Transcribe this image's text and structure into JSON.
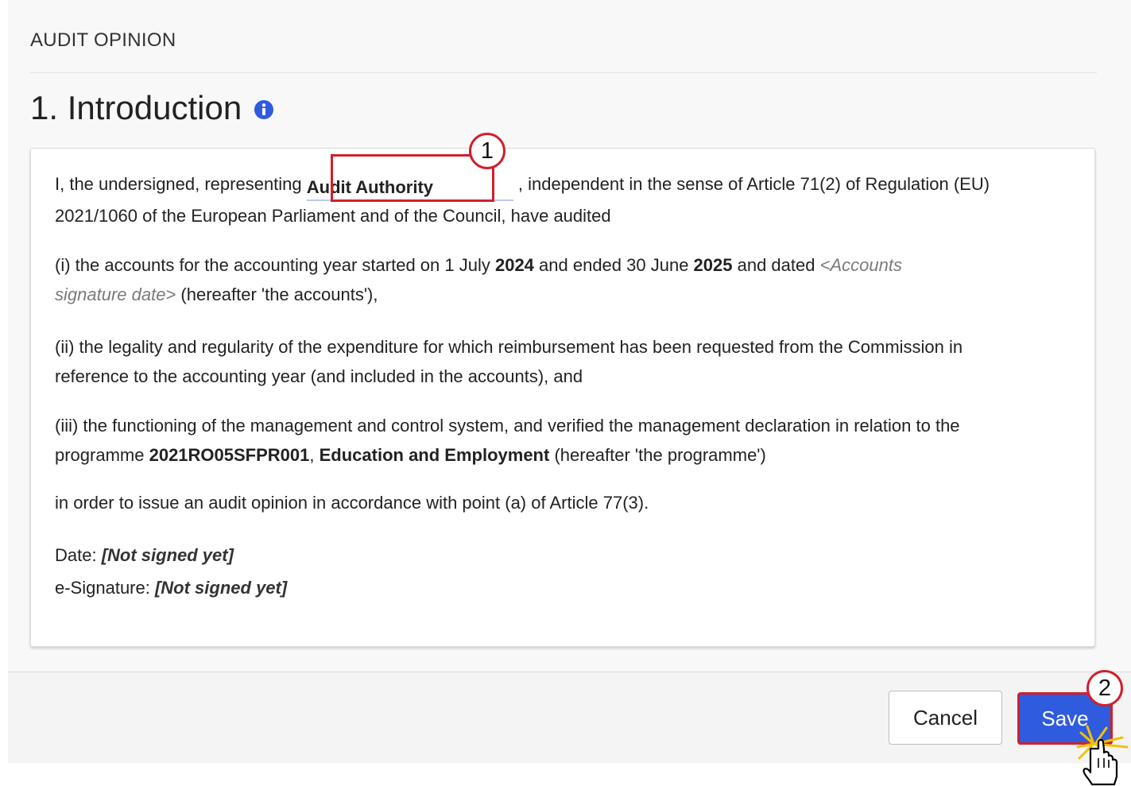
{
  "section": {
    "header": "AUDIT OPINION"
  },
  "title": "1. Introduction",
  "body": {
    "p1": {
      "prefix": "I, the undersigned, representing",
      "authority": "Audit Authority",
      "suffix": ", independent in the sense of Article 71(2) of Regulation (EU)",
      "line2": "2021/1060 of the European Parliament and of the Council, have audited"
    },
    "p2": {
      "part1": "(i) the accounts for the accounting year started on 1 July ",
      "year_start": "2024",
      "part2": " and ended 30 June ",
      "year_end": "2025",
      "part3": " and dated ",
      "placeholder_a": "<Accounts",
      "placeholder_b": "signature date>",
      "part4": " (hereafter 'the accounts'),"
    },
    "p3": {
      "line1": "(ii) the legality and regularity of the expenditure for which reimbursement has been requested from the Commission in",
      "line2": "reference to the accounting year (and included in the accounts), and"
    },
    "p4": {
      "line1": "(iii) the functioning of the management and control system, and verified the management declaration in relation to the",
      "prefix": "programme ",
      "cci": "2021RO05SFPR001",
      "sep": ", ",
      "programme_title": "Education and Employment",
      "suffix": " (hereafter 'the programme')"
    },
    "p5": "in order to issue an audit opinion in accordance with point (a) of Article 77(3).",
    "date_label": "Date: ",
    "date_value": "[Not signed yet]",
    "esig_label": "e-Signature: ",
    "esig_value": "[Not signed yet]"
  },
  "footer": {
    "cancel_label": "Cancel",
    "save_label": "Save"
  },
  "annotations": {
    "step1": "1",
    "step2": "2",
    "highlight_color": "#d21f2b"
  },
  "colors": {
    "primary_button": "#2f5bdf",
    "info_icon": "#2f5bdf"
  },
  "icons": {
    "info": "info-icon",
    "cursor": "hand-pointer-icon"
  }
}
